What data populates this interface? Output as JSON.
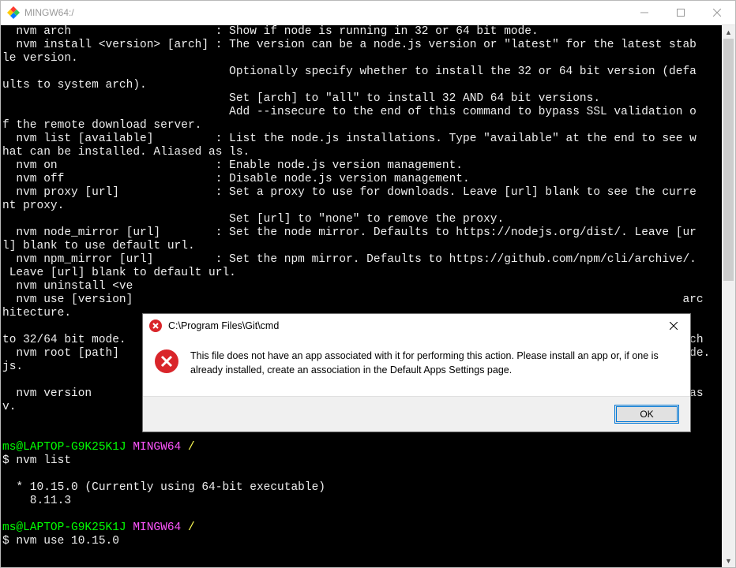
{
  "window": {
    "title": "MINGW64:/"
  },
  "terminal": {
    "lines": [
      {
        "segs": [
          {
            "t": "  nvm arch                     : Show if node is running in 32 or 64 bit mode."
          }
        ]
      },
      {
        "segs": [
          {
            "t": "  nvm install <version> [arch] : The version can be a node.js version or \"latest\" for the latest stab"
          }
        ]
      },
      {
        "segs": [
          {
            "t": "le version."
          }
        ]
      },
      {
        "segs": [
          {
            "t": "                                 Optionally specify whether to install the 32 or 64 bit version (defa"
          }
        ]
      },
      {
        "segs": [
          {
            "t": "ults to system arch)."
          }
        ]
      },
      {
        "segs": [
          {
            "t": "                                 Set [arch] to \"all\" to install 32 AND 64 bit versions."
          }
        ]
      },
      {
        "segs": [
          {
            "t": "                                 Add --insecure to the end of this command to bypass SSL validation o"
          }
        ]
      },
      {
        "segs": [
          {
            "t": "f the remote download server."
          }
        ]
      },
      {
        "segs": [
          {
            "t": "  nvm list [available]         : List the node.js installations. Type \"available\" at the end to see w"
          }
        ]
      },
      {
        "segs": [
          {
            "t": "hat can be installed. Aliased as ls."
          }
        ]
      },
      {
        "segs": [
          {
            "t": "  nvm on                       : Enable node.js version management."
          }
        ]
      },
      {
        "segs": [
          {
            "t": "  nvm off                      : Disable node.js version management."
          }
        ]
      },
      {
        "segs": [
          {
            "t": "  nvm proxy [url]              : Set a proxy to use for downloads. Leave [url] blank to see the curre"
          }
        ]
      },
      {
        "segs": [
          {
            "t": "nt proxy."
          }
        ]
      },
      {
        "segs": [
          {
            "t": "                                 Set [url] to \"none\" to remove the proxy."
          }
        ]
      },
      {
        "segs": [
          {
            "t": "  nvm node_mirror [url]        : Set the node mirror. Defaults to https://nodejs.org/dist/. Leave [ur"
          }
        ]
      },
      {
        "segs": [
          {
            "t": "l] blank to use default url."
          }
        ]
      },
      {
        "segs": [
          {
            "t": "  nvm npm_mirror [url]         : Set the npm mirror. Defaults to https://github.com/npm/cli/archive/."
          }
        ]
      },
      {
        "segs": [
          {
            "t": " Leave [url] blank to default url."
          }
        ]
      },
      {
        "segs": [
          {
            "t": "  nvm uninstall <ve"
          }
        ]
      },
      {
        "segs": [
          {
            "t": "  nvm use [version]                                                                                arc"
          }
        ]
      },
      {
        "segs": [
          {
            "t": "hitecture."
          }
        ]
      },
      {
        "segs": [
          {
            "t": ""
          }
        ]
      },
      {
        "segs": [
          {
            "t": "to 32/64 bit mode.                                                                                 tch"
          }
        ]
      },
      {
        "segs": [
          {
            "t": "  nvm root [path]                                                                                  ode."
          }
        ]
      },
      {
        "segs": [
          {
            "t": "js."
          }
        ]
      },
      {
        "segs": [
          {
            "t": ""
          }
        ]
      },
      {
        "segs": [
          {
            "t": "  nvm version                                                                                       as "
          }
        ]
      },
      {
        "segs": [
          {
            "t": "v."
          }
        ]
      },
      {
        "segs": [
          {
            "t": ""
          }
        ]
      },
      {
        "segs": [
          {
            "t": ""
          }
        ]
      },
      {
        "segs": [
          {
            "t": "ms@LAPTOP-G9K25K1J ",
            "cls": "term-green"
          },
          {
            "t": "MINGW64 ",
            "cls": "term-magenta"
          },
          {
            "t": "/",
            "cls": "term-yellow"
          }
        ]
      },
      {
        "segs": [
          {
            "t": "$ nvm list"
          }
        ]
      },
      {
        "segs": [
          {
            "t": ""
          }
        ]
      },
      {
        "segs": [
          {
            "t": "  * 10.15.0 (Currently using 64-bit executable)"
          }
        ]
      },
      {
        "segs": [
          {
            "t": "    8.11.3"
          }
        ]
      },
      {
        "segs": [
          {
            "t": ""
          }
        ]
      },
      {
        "segs": [
          {
            "t": "ms@LAPTOP-G9K25K1J ",
            "cls": "term-green"
          },
          {
            "t": "MINGW64 ",
            "cls": "term-magenta"
          },
          {
            "t": "/",
            "cls": "term-yellow"
          }
        ]
      },
      {
        "segs": [
          {
            "t": "$ nvm use 10.15.0"
          }
        ]
      }
    ]
  },
  "dialog": {
    "title": "C:\\Program Files\\Git\\cmd",
    "message": "This file does not have an app associated with it for performing this action. Please install an app or, if one is already installed, create an association in the Default Apps Settings page.",
    "ok": "OK"
  }
}
